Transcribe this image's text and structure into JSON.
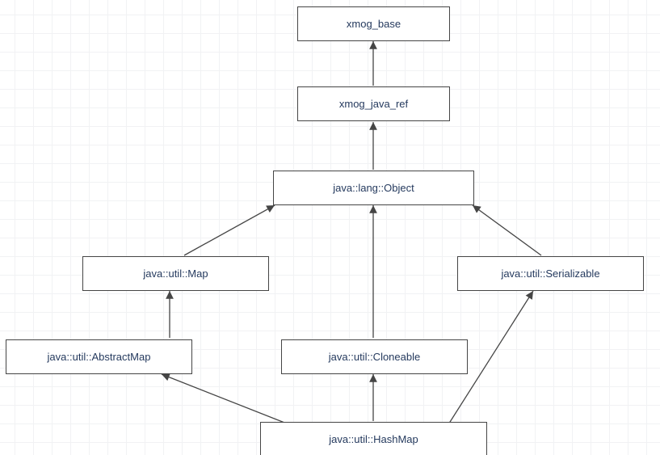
{
  "diagram": {
    "type": "class-inheritance",
    "nodes": {
      "xmog_base": {
        "label": "xmog_base"
      },
      "xmog_java_ref": {
        "label": "xmog_java_ref"
      },
      "object": {
        "label": "java::lang::Object"
      },
      "map": {
        "label": "java::util::Map"
      },
      "serializable": {
        "label": "java::util::Serializable"
      },
      "abstractmap": {
        "label": "java::util::AbstractMap"
      },
      "cloneable": {
        "label": "java::util::Cloneable"
      },
      "hashmap": {
        "label": "java::util::HashMap"
      }
    },
    "edges": [
      {
        "from": "xmog_java_ref",
        "to": "xmog_base"
      },
      {
        "from": "object",
        "to": "xmog_java_ref"
      },
      {
        "from": "map",
        "to": "object"
      },
      {
        "from": "cloneable",
        "to": "object"
      },
      {
        "from": "serializable",
        "to": "object"
      },
      {
        "from": "abstractmap",
        "to": "map"
      },
      {
        "from": "hashmap",
        "to": "abstractmap"
      },
      {
        "from": "hashmap",
        "to": "cloneable"
      },
      {
        "from": "hashmap",
        "to": "serializable"
      }
    ]
  },
  "chart_data": {
    "type": "graph",
    "title": "",
    "directed": true,
    "nodes": [
      "xmog_base",
      "xmog_java_ref",
      "java::lang::Object",
      "java::util::Map",
      "java::util::Serializable",
      "java::util::AbstractMap",
      "java::util::Cloneable",
      "java::util::HashMap"
    ],
    "edges": [
      [
        "xmog_java_ref",
        "xmog_base"
      ],
      [
        "java::lang::Object",
        "xmog_java_ref"
      ],
      [
        "java::util::Map",
        "java::lang::Object"
      ],
      [
        "java::util::Cloneable",
        "java::lang::Object"
      ],
      [
        "java::util::Serializable",
        "java::lang::Object"
      ],
      [
        "java::util::AbstractMap",
        "java::util::Map"
      ],
      [
        "java::util::HashMap",
        "java::util::AbstractMap"
      ],
      [
        "java::util::HashMap",
        "java::util::Cloneable"
      ],
      [
        "java::util::HashMap",
        "java::util::Serializable"
      ]
    ]
  }
}
